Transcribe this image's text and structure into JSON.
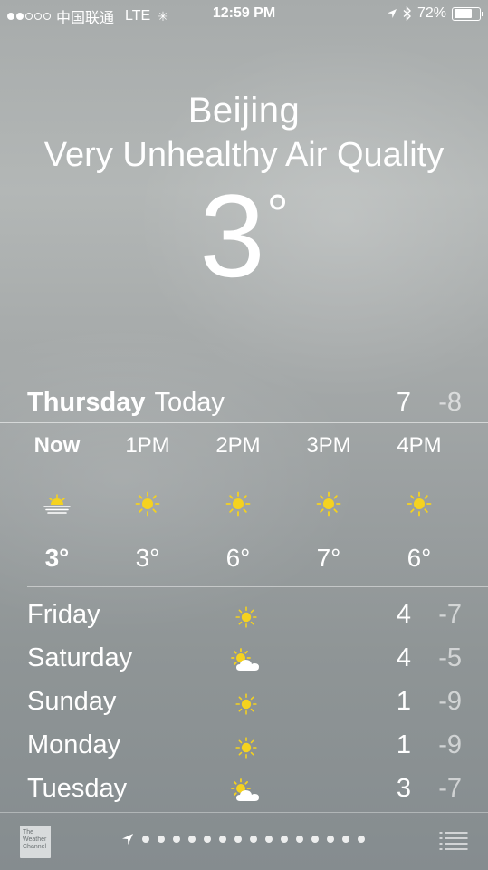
{
  "status_bar": {
    "carrier": "中国联通",
    "network": "LTE",
    "time": "12:59 PM",
    "battery": "72%",
    "battery_fraction": 0.72,
    "signal_filled": 2,
    "signal_total": 5
  },
  "location": {
    "city": "Beijing",
    "condition": "Very Unhealthy Air Quality",
    "temperature": "3",
    "degree_symbol": "°"
  },
  "today": {
    "day": "Thursday",
    "label": "Today",
    "high": "7",
    "low": "-8"
  },
  "hourly": [
    {
      "time": "Now",
      "icon": "sunrise-icon",
      "temp": "3°"
    },
    {
      "time": "1PM",
      "icon": "sun-icon",
      "temp": "3°"
    },
    {
      "time": "2PM",
      "icon": "sun-icon",
      "temp": "6°"
    },
    {
      "time": "3PM",
      "icon": "sun-icon",
      "temp": "7°"
    },
    {
      "time": "4PM",
      "icon": "sun-icon",
      "temp": "6°"
    }
  ],
  "daily": [
    {
      "day": "Friday",
      "icon": "sun-icon",
      "high": "4",
      "low": "-7"
    },
    {
      "day": "Saturday",
      "icon": "partly-cloudy-icon",
      "high": "4",
      "low": "-5"
    },
    {
      "day": "Sunday",
      "icon": "sun-icon",
      "high": "1",
      "low": "-9"
    },
    {
      "day": "Monday",
      "icon": "sun-icon",
      "high": "1",
      "low": "-9"
    },
    {
      "day": "Tuesday",
      "icon": "partly-cloudy-icon",
      "high": "3",
      "low": "-7"
    }
  ],
  "footer": {
    "logo_text": "The Weather Channel",
    "page_count": 15,
    "icons": [
      "location-arrow-icon",
      "list-icon"
    ]
  },
  "colors": {
    "sun": "#f5d21f",
    "text": "#ffffff",
    "low_temp": "rgba(255,255,255,0.6)"
  }
}
